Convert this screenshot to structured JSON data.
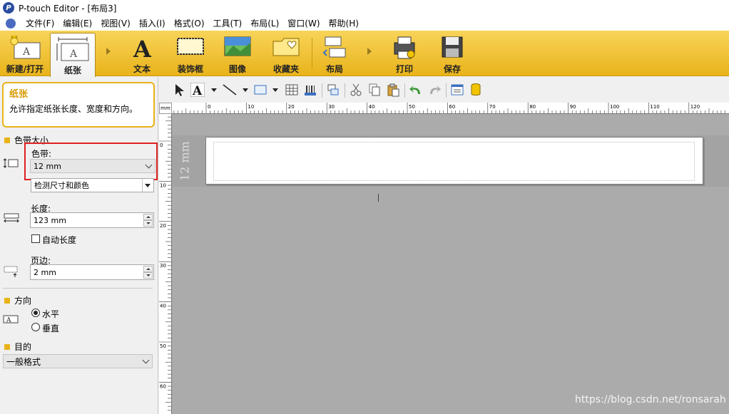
{
  "window": {
    "title": "P-touch Editor - [布局3]",
    "app_icon": "p-touch-logo-icon"
  },
  "menu": [
    "文件(F)",
    "编辑(E)",
    "视图(V)",
    "插入(I)",
    "格式(O)",
    "工具(T)",
    "布局(L)",
    "窗口(W)",
    "帮助(H)"
  ],
  "ribbon": {
    "new_open": "新建/打开",
    "paper": "纸张",
    "text": "文本",
    "frame": "装饰框",
    "image": "图像",
    "favorites": "收藏夹",
    "layout": "布局",
    "print": "打印",
    "save": "保存"
  },
  "panel": {
    "tip_title": "纸张",
    "tip_desc": "允许指定纸张长度、宽度和方向。",
    "tape_size_heading": "色带大小",
    "tape_label": "色带:",
    "tape_value": "12 mm",
    "detect_value": "检测尺寸和颜色",
    "length_label": "长度:",
    "length_value": "123 mm",
    "auto_length_label": "自动长度",
    "margin_label": "页边:",
    "margin_value": "2 mm",
    "orientation_heading": "方向",
    "horizontal_label": "水平",
    "vertical_label": "垂直",
    "purpose_heading": "目的",
    "purpose_value": "一般格式"
  },
  "ruler": {
    "unit": "mm",
    "h_ticks": [
      "0",
      "10",
      "20",
      "30",
      "40",
      "50",
      "60",
      "70",
      "80",
      "90",
      "100",
      "110",
      "120"
    ],
    "v_ticks": [
      "0",
      "10",
      "20",
      "30",
      "40",
      "50",
      "60"
    ]
  },
  "canvas": {
    "tape_side_label": "12 mm"
  },
  "watermark": "https://blog.csdn.net/ronsarah",
  "colors": {
    "ribbon": "#e9b31a",
    "accent": "#d89a00",
    "highlight": "#e02020",
    "canvas": "#ababab"
  }
}
